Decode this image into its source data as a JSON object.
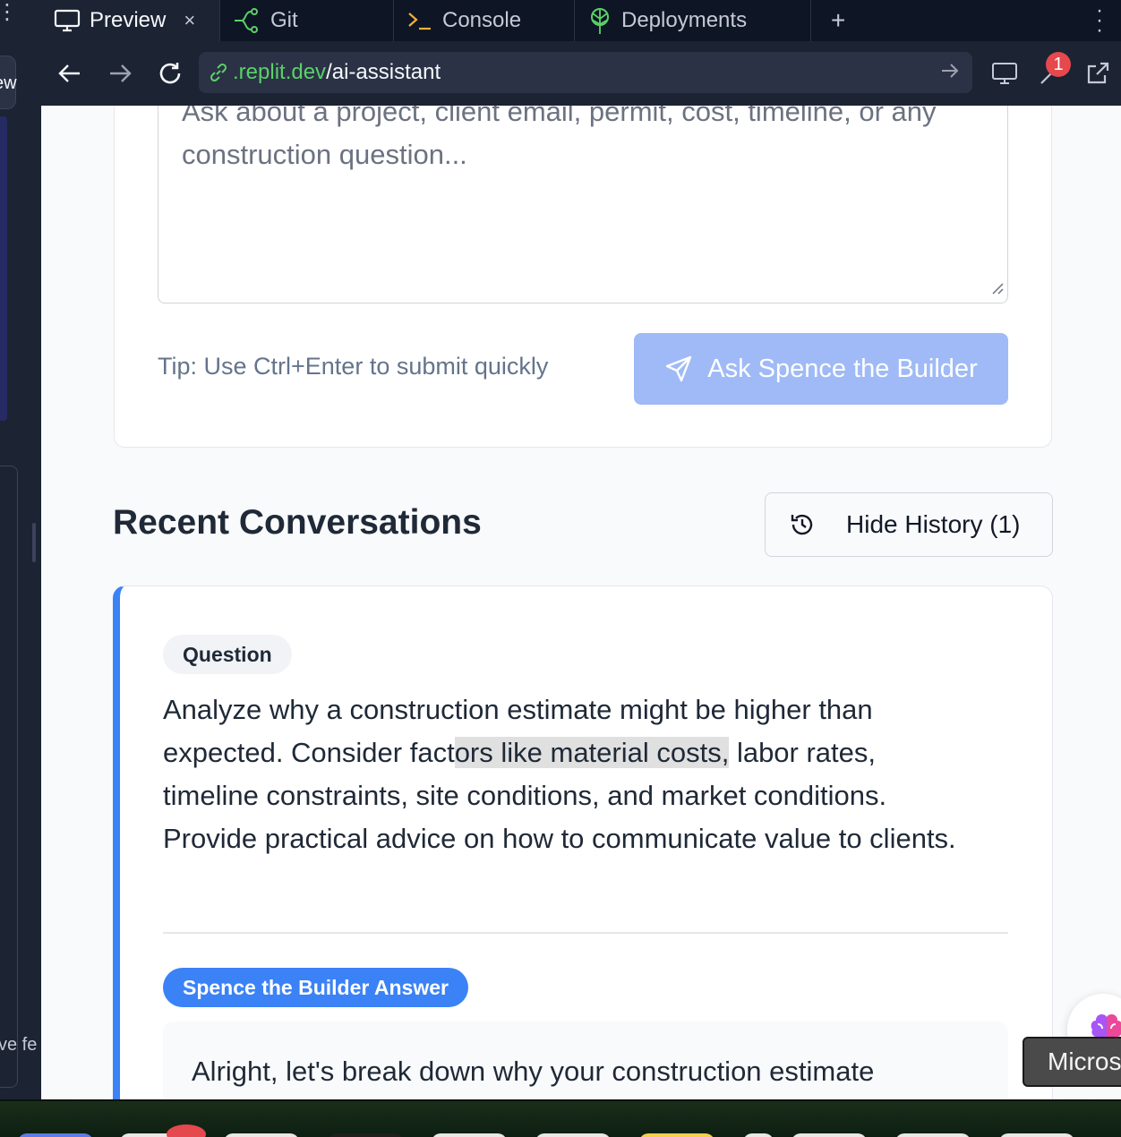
{
  "left_panel": {
    "top_fragment": "ew",
    "bottom_fragment": "ve fe"
  },
  "tabs": [
    {
      "label": "Preview",
      "icon": "monitor-icon",
      "active": true,
      "closable": true
    },
    {
      "label": "Git",
      "icon": "git-branch-icon",
      "active": false
    },
    {
      "label": "Console",
      "icon": "terminal-icon",
      "active": false
    },
    {
      "label": "Deployments",
      "icon": "deploy-icon",
      "active": false
    }
  ],
  "urlbar": {
    "domain": ".replit.dev",
    "path": "/ai-assistant",
    "notification_count": "1"
  },
  "assistant": {
    "placeholder": "Ask about a project, client email, permit, cost, timeline, or any construction question...",
    "tip": "Tip: Use Ctrl+Enter to submit quickly",
    "ask_button": "Ask Spence the Builder"
  },
  "history": {
    "title": "Recent Conversations",
    "toggle_button": "Hide History (1)"
  },
  "conversation": {
    "question_label": "Question",
    "question_parts": [
      "Analyze why a construction estimate might be higher than expected. Consider fact",
      "ors like material costs,",
      " labor rates, timeline constraints, site conditions, and market conditions. Provide practical advice on how to communicate value to clients."
    ],
    "answer_label": "Spence the Builder Answer",
    "answer_preview": "Alright, let's break down why your construction estimate"
  },
  "tooltip": {
    "text": "Micros"
  },
  "colors": {
    "accent": "#3b82f6",
    "button_disabled": "#9fbaf6",
    "url_domain": "#5ad168",
    "badge": "#e5484d"
  }
}
